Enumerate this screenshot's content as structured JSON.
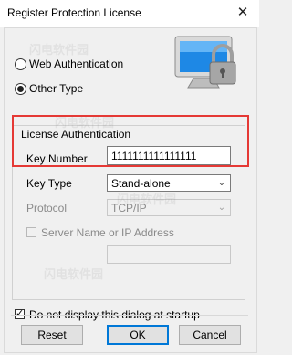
{
  "window": {
    "title": "Register Protection License",
    "close_icon": "close-icon"
  },
  "auth_type": {
    "options": [
      {
        "label": "Web Authentication",
        "selected": false
      },
      {
        "label": "Other Type",
        "selected": true
      }
    ]
  },
  "group": {
    "title": "License Authentication",
    "key_number_label": "Key Number",
    "key_number_value": "1111111111111111",
    "key_type_label": "Key Type",
    "key_type_value": "Stand-alone",
    "protocol_label": "Protocol",
    "protocol_value": "TCP/IP",
    "server_checkbox_label": "Server Name or IP Address",
    "server_checked": false,
    "server_value": ""
  },
  "startup_checkbox": {
    "label": "Do not display this dialog at startup",
    "checked": true
  },
  "buttons": {
    "reset": "Reset",
    "ok": "OK",
    "cancel": "Cancel"
  },
  "watermark_text": "闪电软件园",
  "colors": {
    "highlight": "#e53935",
    "accent": "#0078d7"
  }
}
